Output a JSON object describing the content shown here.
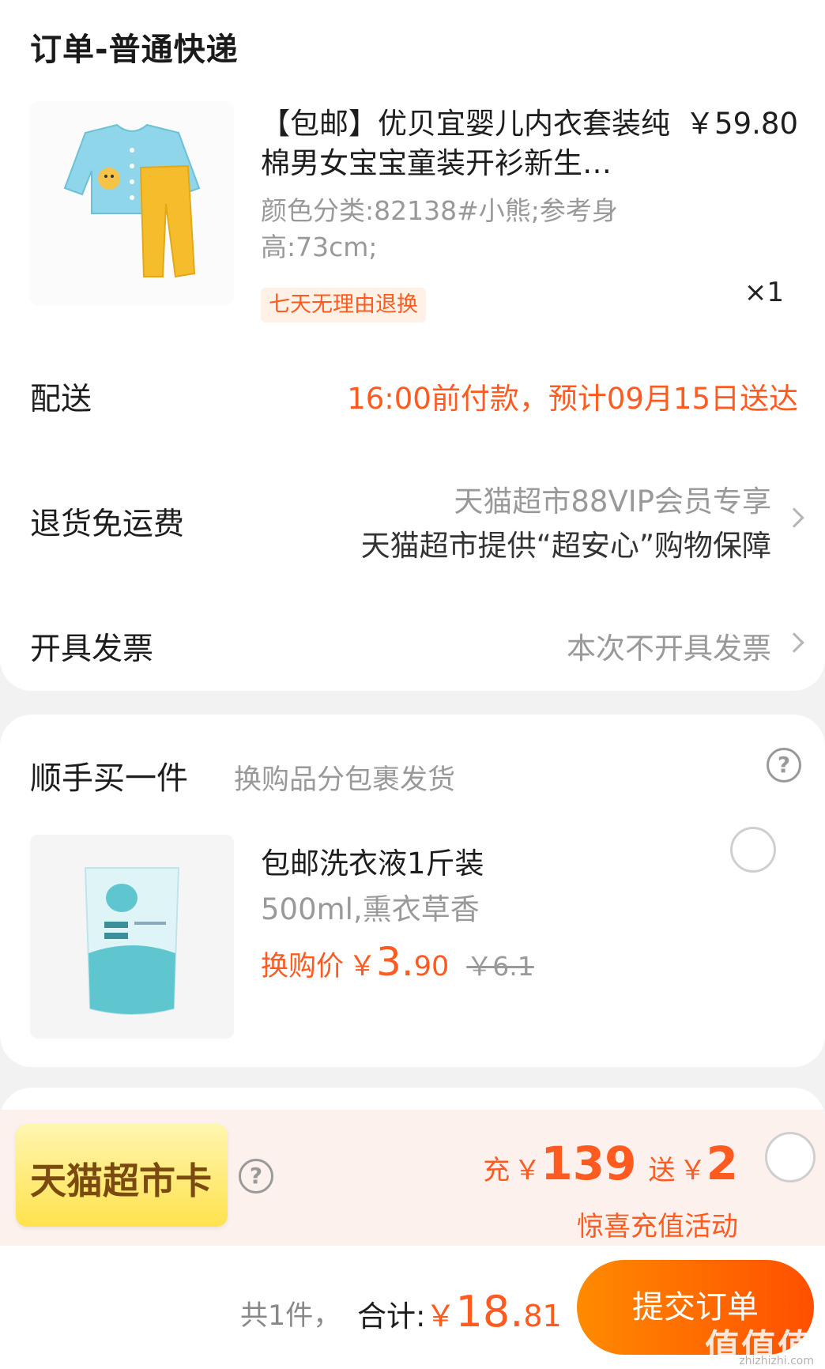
{
  "order": {
    "title": "订单-普通快递",
    "product": {
      "name": "【包邮】优贝宜婴儿内衣套装纯棉男女宝宝童装开衫新生…",
      "price": "￥59.80",
      "spec": "颜色分类:82138#小熊;参考身高:73cm;",
      "qty": "×1",
      "tag": "七天无理由退换"
    },
    "delivery": {
      "label": "配送",
      "value": "16:00前付款，预计09月15日送达"
    },
    "return_fee": {
      "label": "退货免运费",
      "line1": "天猫超市88VIP会员专享",
      "line2": "天猫超市提供“超安心”购物保障"
    },
    "invoice": {
      "label": "开具发票",
      "value": "本次不开具发票"
    }
  },
  "addon": {
    "title": "顺手买一件",
    "subtitle": "换购品分包裹发货",
    "help": "?",
    "item": {
      "name": "包邮洗衣液1斤装",
      "spec": "500ml,熏衣草香",
      "price_label": "换购价",
      "yen": "￥",
      "price_int": "3.",
      "price_dec": "90",
      "orig_price": "￥6.1"
    }
  },
  "tmall_card": {
    "badge": "天猫超市卡",
    "help": "?",
    "recharge_label": "充",
    "recharge_yen": "￥",
    "recharge_amount": "139",
    "bonus_label": "送",
    "bonus_yen": "￥",
    "bonus_amount": "2",
    "activity": "惊喜充值活动"
  },
  "footer": {
    "count": "共1件，",
    "total_label": "合计:",
    "yen": "￥",
    "total_int": "18.",
    "total_dec": "81",
    "submit": "提交订单",
    "watermark": "值值值",
    "watermark_url": "zhizhizhi.com"
  },
  "colors": {
    "accent": "#ff5a1f",
    "button_start": "#ff8a00",
    "button_end": "#ff4f00"
  }
}
